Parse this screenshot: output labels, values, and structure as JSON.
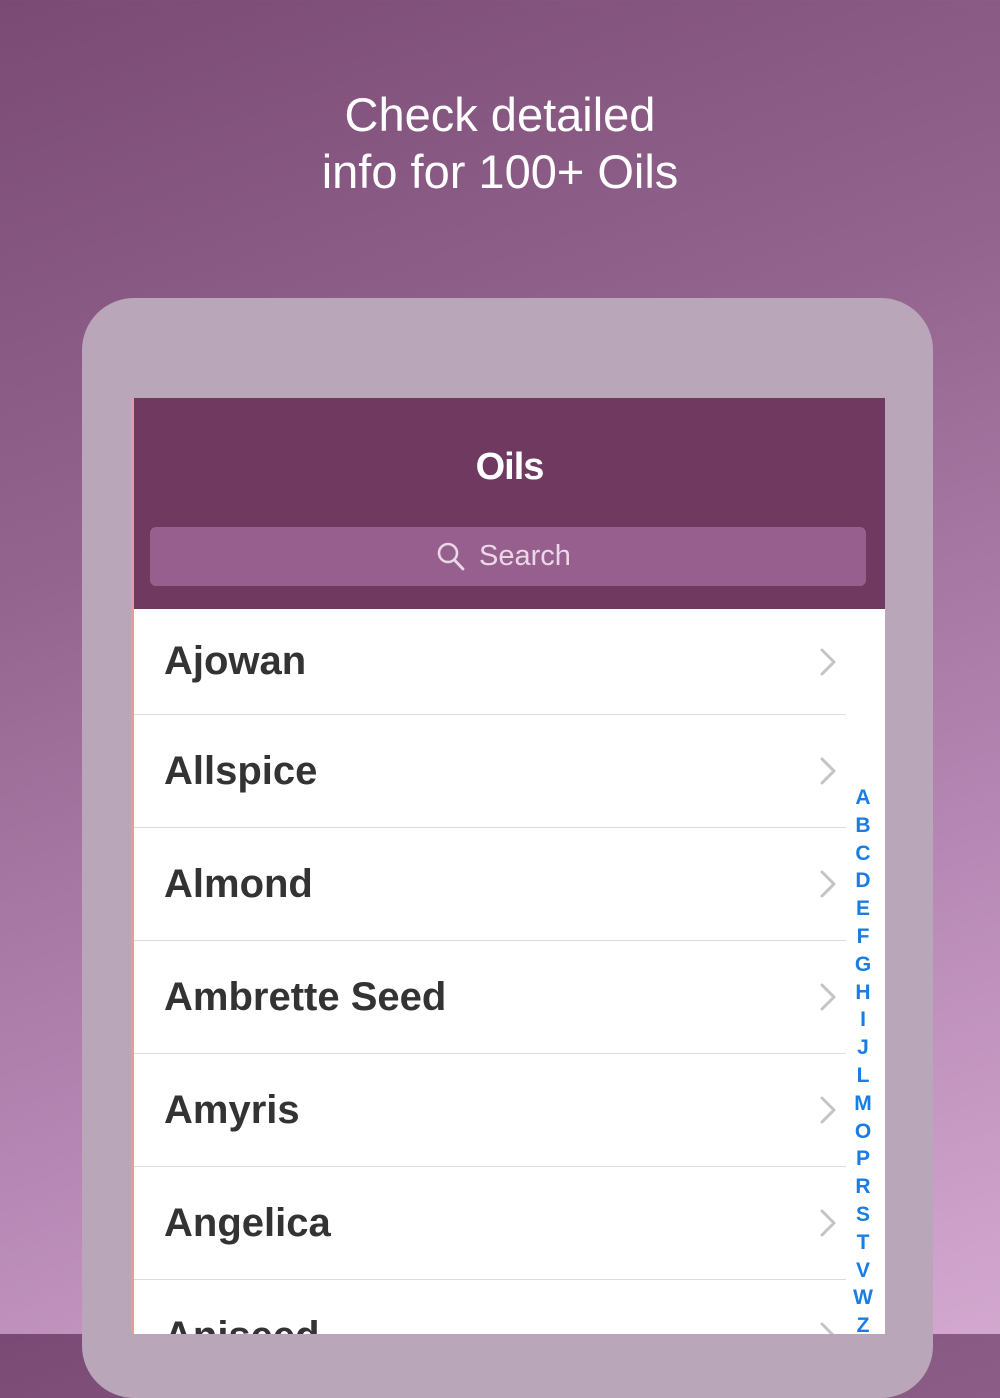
{
  "promo": {
    "line1": "Check detailed",
    "line2": "info for 100+ Oils"
  },
  "navbar": {
    "title": "Oils"
  },
  "search": {
    "placeholder": "Search"
  },
  "oils": [
    "Ajowan",
    "Allspice",
    "Almond",
    "Ambrette Seed",
    "Amyris",
    "Angelica",
    "Aniseed"
  ],
  "index_letters": [
    "A",
    "B",
    "C",
    "D",
    "E",
    "F",
    "G",
    "H",
    "I",
    "J",
    "L",
    "M",
    "O",
    "P",
    "R",
    "S",
    "T",
    "V",
    "W",
    "Z"
  ],
  "colors": {
    "nav": "#6f3960",
    "search": "#965f8e",
    "index": "#1a7de3"
  }
}
